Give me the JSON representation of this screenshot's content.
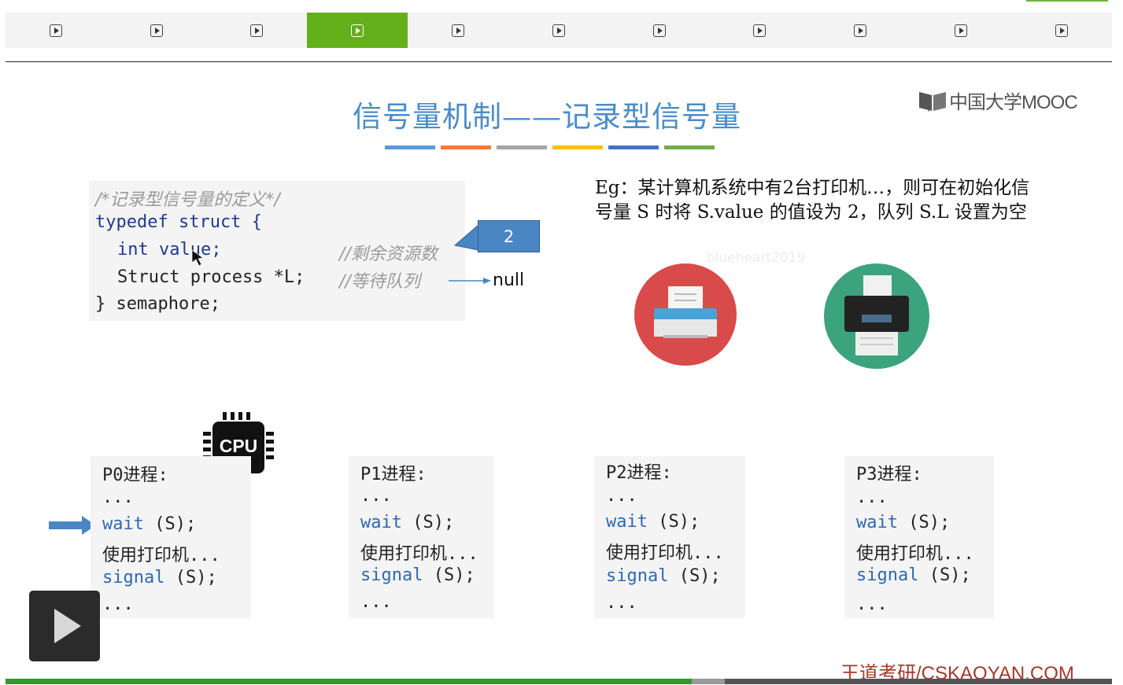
{
  "tabs": [
    {
      "icon": "play-icon"
    },
    {
      "icon": "play-icon"
    },
    {
      "icon": "play-icon"
    },
    {
      "icon": "play-icon",
      "active": true
    },
    {
      "icon": "play-icon"
    },
    {
      "icon": "play-icon"
    },
    {
      "icon": "play-icon"
    },
    {
      "icon": "play-icon"
    },
    {
      "icon": "play-icon"
    },
    {
      "icon": "play-icon"
    },
    {
      "icon": "play-icon"
    }
  ],
  "slide": {
    "title": "信号量机制——记录型信号量",
    "title_color": "#4a8cc9",
    "bar_colors": [
      "#5b9bd5",
      "#ed7d31",
      "#a5a5a5",
      "#ffc000",
      "#4472c4",
      "#70ad47"
    ],
    "logo_text": "中国大学MOOC",
    "code": {
      "comment": "/*记录型信号量的定义*/",
      "line1": "typedef struct {",
      "line2": "int value;",
      "line2_comment": "//剩余资源数",
      "line3": "Struct process *L;",
      "line3_comment": "//等待队列",
      "line4": "} semaphore;"
    },
    "callout_value": "2",
    "null_label": "null",
    "example_text": "Eg：某计算机系统中有2台打印机…，则可在初始化信号量 S 时将 S.value 的值设为 2，队列 S.L 设置为空",
    "watermark": "blueheart2019",
    "cpu_label": "CPU",
    "processes": [
      {
        "title": "P0进程:",
        "dots": "...",
        "wait": "wait",
        "wait_arg": " (S);",
        "use": "使用打印机...",
        "signal": "signal",
        "signal_arg": " (S);",
        "end": "..."
      },
      {
        "title": "P1进程:",
        "dots": "...",
        "wait": "wait",
        "wait_arg": " (S);",
        "use": "使用打印机...",
        "signal": "signal",
        "signal_arg": " (S);",
        "end": "..."
      },
      {
        "title": "P2进程:",
        "dots": "...",
        "wait": "wait",
        "wait_arg": " (S);",
        "use": "使用打印机...",
        "signal": "signal",
        "signal_arg": " (S);",
        "end": "..."
      },
      {
        "title": "P3进程:",
        "dots": "...",
        "wait": "wait",
        "wait_arg": " (S);",
        "use": "使用打印机...",
        "signal": "signal",
        "signal_arg": " (S);",
        "end": "..."
      }
    ],
    "footer": "王道考研/CSKAOYAN.COM"
  },
  "player": {
    "progress": 0.62,
    "buffered": 0.65,
    "accent": "#2e9a2e"
  }
}
